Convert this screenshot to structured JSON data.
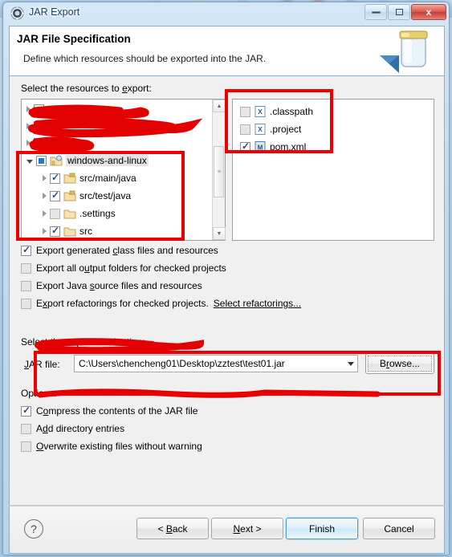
{
  "window": {
    "title": "JAR Export",
    "icon": "jar-export-icon",
    "buttons": {
      "minimize": "minimize-icon",
      "maximize": "maximize-icon",
      "close": "x"
    }
  },
  "header": {
    "title": "JAR File Specification",
    "subtitle": "Define which resources should be exported into the JAR.",
    "graphic": "jar-wizard-icon"
  },
  "resources": {
    "label": "Select the resources to export:",
    "tree": [
      {
        "name": "",
        "redacted": true,
        "state": "unchecked",
        "expandable": true,
        "expanded": false,
        "indent": 0,
        "icon": "project-icon"
      },
      {
        "name": "",
        "redacted": true,
        "state": "unchecked",
        "expandable": true,
        "expanded": false,
        "indent": 0,
        "icon": "project-icon"
      },
      {
        "name": "",
        "redacted": true,
        "state": "unchecked",
        "expandable": true,
        "expanded": false,
        "indent": 0,
        "icon": "project-icon"
      },
      {
        "name": "windows-and-linux",
        "redacted": false,
        "state": "partial",
        "expandable": true,
        "expanded": true,
        "indent": 0,
        "icon": "java-project-icon",
        "selected": true
      },
      {
        "name": "src/main/java",
        "redacted": false,
        "state": "checked",
        "expandable": true,
        "expanded": false,
        "indent": 1,
        "icon": "source-folder-icon"
      },
      {
        "name": "src/test/java",
        "redacted": false,
        "state": "checked",
        "expandable": true,
        "expanded": false,
        "indent": 1,
        "icon": "source-folder-icon"
      },
      {
        "name": ".settings",
        "redacted": false,
        "state": "unchecked",
        "expandable": true,
        "expanded": false,
        "indent": 1,
        "icon": "folder-icon"
      },
      {
        "name": "src",
        "redacted": false,
        "state": "checked",
        "expandable": true,
        "expanded": false,
        "indent": 1,
        "icon": "folder-icon"
      }
    ],
    "files": [
      {
        "name": ".classpath",
        "state": "unchecked",
        "icon": "xml-file-icon"
      },
      {
        "name": ".project",
        "state": "unchecked",
        "icon": "xml-file-icon"
      },
      {
        "name": "pom.xml",
        "state": "checked",
        "icon": "maven-file-icon"
      }
    ]
  },
  "export_options": [
    {
      "label": "Export generated class files and resources",
      "checked": true,
      "mnemonic": "c"
    },
    {
      "label": "Export all output folders for checked projects",
      "checked": false,
      "mnemonic": "u"
    },
    {
      "label": "Export Java source files and resources",
      "checked": false,
      "mnemonic": "s"
    },
    {
      "label": "Export refactorings for checked projects.",
      "checked": false,
      "mnemonic": "x",
      "link": "Select refactorings..."
    }
  ],
  "destination": {
    "label": "Select the export destination:",
    "field_label": "JAR file:",
    "value": "C:\\Users\\chencheng01\\Desktop\\zztest\\test01.jar",
    "browse_label": "Browse..."
  },
  "options": {
    "label": "Options:",
    "items": [
      {
        "label": "Compress the contents of the JAR file",
        "checked": true
      },
      {
        "label": "Add directory entries",
        "checked": false
      },
      {
        "label": "Overwrite existing files without warning",
        "checked": false
      }
    ]
  },
  "footer": {
    "help": "?",
    "back": "< Back",
    "next": "Next >",
    "finish": "Finish",
    "cancel": "Cancel"
  },
  "colors": {
    "annotation": "#ee0000",
    "accent": "#3c9ad4",
    "titlebar": "#bcd8ee"
  }
}
